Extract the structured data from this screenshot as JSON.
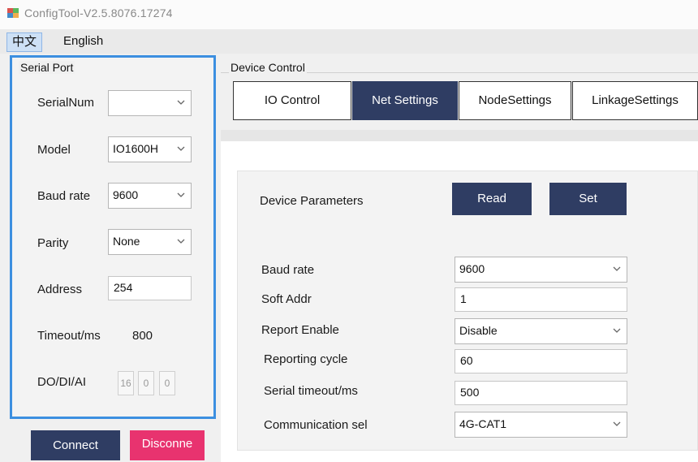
{
  "window": {
    "title": "ConfigTool-V2.5.8076.17274"
  },
  "menu": {
    "chinese": "中文",
    "english": "English"
  },
  "serial_port": {
    "legend": "Serial Port",
    "serialnum_label": "SerialNum",
    "serialnum_value": "",
    "model_label": "Model",
    "model_value": "IO1600H",
    "baud_label": "Baud rate",
    "baud_value": "9600",
    "parity_label": "Parity",
    "parity_value": "None",
    "address_label": "Address",
    "address_value": "254",
    "timeout_label": "Timeout/ms",
    "timeout_value": "800",
    "dodiai_label": "DO/DI/AI",
    "dodiai_values": [
      "16",
      "0",
      "0"
    ],
    "connect_label": "Connect",
    "disconnect_label": "Disconne"
  },
  "device_control": {
    "legend": "Device Control",
    "tabs": [
      {
        "label": "IO Control"
      },
      {
        "label": "Net Settings"
      },
      {
        "label": "NodeSettings"
      },
      {
        "label": "LinkageSettings"
      }
    ],
    "active_tab": "Net Settings"
  },
  "device_parameters": {
    "title": "Device Parameters",
    "read_label": "Read",
    "set_label": "Set",
    "fields": {
      "baud_rate_label": "Baud rate",
      "baud_rate_value": "9600",
      "soft_addr_label": "Soft Addr",
      "soft_addr_value": "1",
      "report_enable_label": "Report Enable",
      "report_enable_value": "Disable",
      "reporting_cycle_label": "Reporting cycle",
      "reporting_cycle_value": "60",
      "serial_timeout_label": "Serial timeout/ms",
      "serial_timeout_value": "500",
      "communication_label": "Communication sel",
      "communication_value": "4G-CAT1"
    }
  },
  "colors": {
    "accent_navy": "#2f3d63",
    "disconnect_pink": "#e8336f",
    "highlight_border": "#3c8fe0"
  },
  "icons": {
    "app": "app-icon",
    "dropdown": "chevron-down-icon"
  }
}
